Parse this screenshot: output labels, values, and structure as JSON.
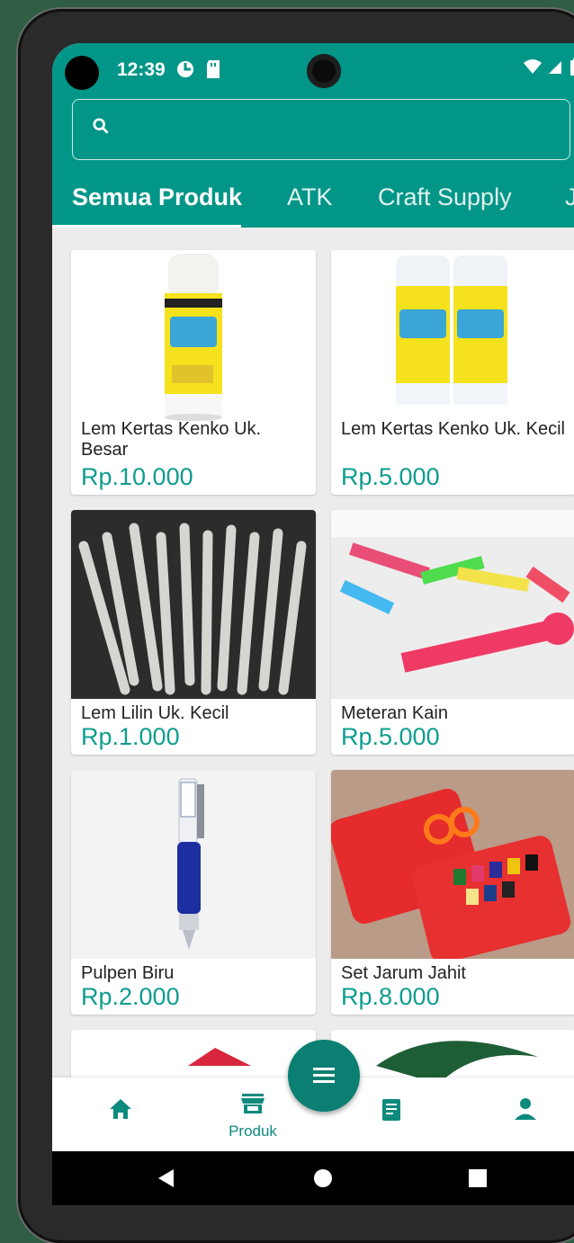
{
  "status": {
    "time": "12:39",
    "icons": [
      "data-saver-icon",
      "sd-card-icon",
      "wifi-icon",
      "signal-icon",
      "battery-icon"
    ]
  },
  "search": {
    "placeholder": "",
    "value": ""
  },
  "tabs": [
    {
      "label": "Semua Produk",
      "active": true
    },
    {
      "label": "ATK",
      "active": false
    },
    {
      "label": "Craft Supply",
      "active": false
    },
    {
      "label": "Ja",
      "active": false
    }
  ],
  "products": [
    {
      "name": "Lem Kertas Kenko Uk. Besar",
      "price": "Rp.10.000",
      "image": "glue-stick-large-image"
    },
    {
      "name": "Lem Kertas Kenko Uk. Kecil",
      "price": "Rp.5.000",
      "image": "glue-stick-small-image"
    },
    {
      "name": "Lem Lilin Uk. Kecil",
      "price": "Rp.1.000",
      "image": "glue-sticks-image"
    },
    {
      "name": "Meteran Kain",
      "price": "Rp.5.000",
      "image": "measuring-tape-image"
    },
    {
      "name": "Pulpen Biru",
      "price": "Rp.2.000",
      "image": "blue-pen-image"
    },
    {
      "name": "Set Jarum Jahit",
      "price": "Rp.8.000",
      "image": "sewing-kit-image"
    }
  ],
  "bottom_nav": {
    "items": [
      {
        "icon": "home-icon",
        "label": ""
      },
      {
        "icon": "store-icon",
        "label": "Produk"
      },
      {
        "icon": "receipt-icon",
        "label": ""
      },
      {
        "icon": "person-icon",
        "label": ""
      }
    ],
    "fab_icon": "menu-icon"
  },
  "colors": {
    "primary": "#029688",
    "price": "#0e9d8f",
    "fab": "#0b7f72"
  }
}
